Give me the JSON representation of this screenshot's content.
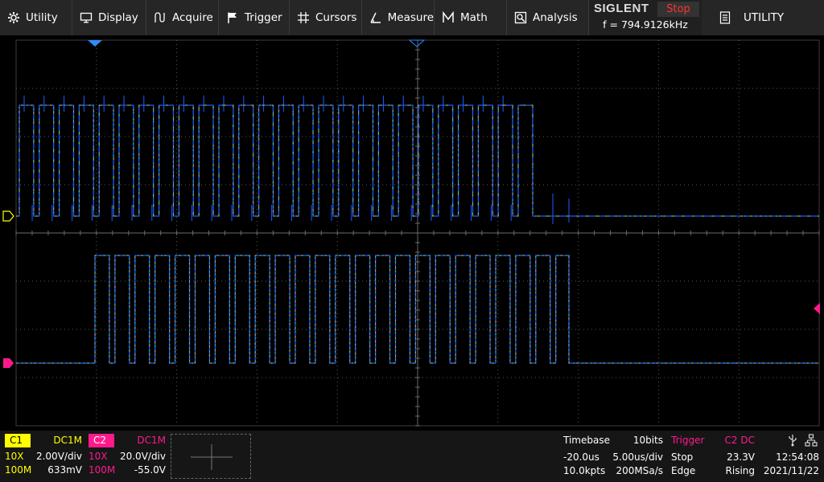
{
  "menu": {
    "items": [
      {
        "label": "Utility",
        "icon": "gear-icon"
      },
      {
        "label": "Display",
        "icon": "monitor-icon"
      },
      {
        "label": "Acquire",
        "icon": "acquire-icon"
      },
      {
        "label": "Trigger",
        "icon": "flag-icon"
      },
      {
        "label": "Cursors",
        "icon": "cursor-crosshair-icon"
      },
      {
        "label": "Measure",
        "icon": "measure-icon"
      },
      {
        "label": "Math",
        "icon": "math-icon"
      },
      {
        "label": "Analysis",
        "icon": "analysis-icon"
      }
    ],
    "brand": "SIGLENT",
    "run_state": "Stop",
    "frequency": "f = 794.9126kHz",
    "utility_panel": "UTILITY"
  },
  "channels": {
    "c1": {
      "name": "C1",
      "coupling": "DC1M",
      "probe": "10X",
      "scale": "2.00V/div",
      "bandwidth": "100M",
      "offset": "633mV",
      "color": "#ffff00"
    },
    "c2": {
      "name": "C2",
      "coupling": "DC1M",
      "probe": "10X",
      "scale": "20.0V/div",
      "bandwidth": "100M",
      "offset": "-55.0V",
      "color": "#ff1a8c"
    }
  },
  "timebase": {
    "title": "Timebase",
    "bits": "10bits",
    "delay": "-20.0us",
    "scale": "5.00us/div",
    "points": "10.0kpts",
    "sample_rate": "200MSa/s"
  },
  "trigger": {
    "title": "Trigger",
    "source": "C2 DC",
    "state": "Stop",
    "level": "23.3V",
    "type": "Edge",
    "slope": "Rising"
  },
  "status": {
    "time": "12:54:08",
    "date": "2021/11/22"
  },
  "colors": {
    "trace": "#1e5bff",
    "trace_overlay_1": "#ffb000",
    "trace_overlay_2": "#40ff40",
    "grid": "#5a5a5a",
    "c1_marker": "#ffff00",
    "c2_marker": "#ff1a8c",
    "trigger_pos_marker": "#2d8cff",
    "menu_bg": "#262626",
    "stop_red": "#ff3333"
  }
}
